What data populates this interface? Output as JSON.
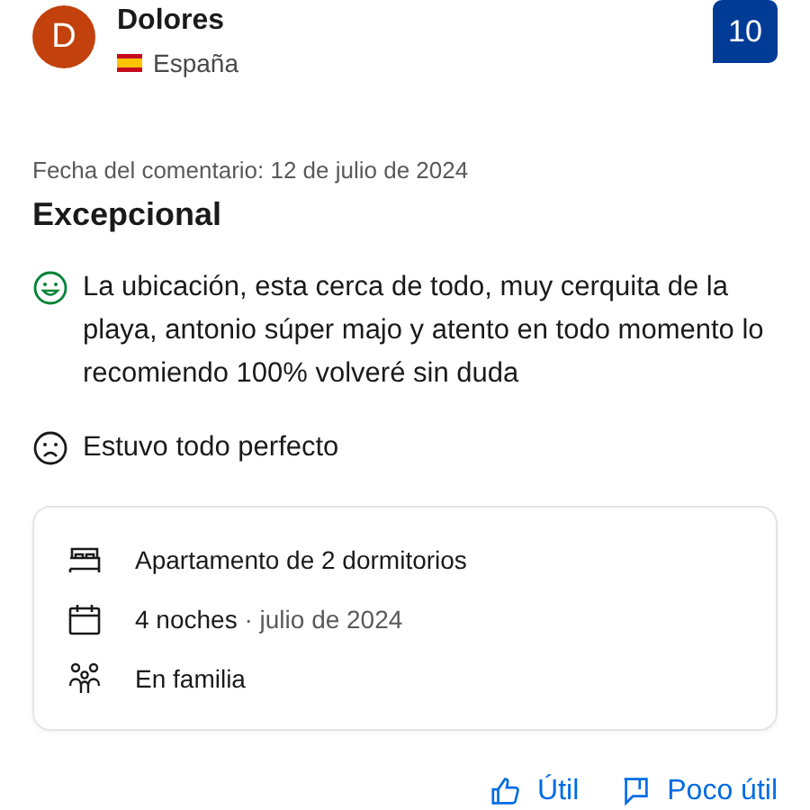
{
  "reviewer": {
    "initial": "D",
    "name": "Dolores",
    "country": "España"
  },
  "score": "10",
  "date": "Fecha del comentario: 12 de julio de 2024",
  "title": "Excepcional",
  "comments": [
    {
      "kind": "positive",
      "text": "La ubicación, esta cerca de todo, muy cerquita de la playa, antonio súper majo y atento en todo momento lo recomiendo 100% volveré sin duda"
    },
    {
      "kind": "negative",
      "text": "Estuvo todo perfecto"
    }
  ],
  "stay": [
    {
      "kind": "room",
      "text": "Apartamento de 2 dormitorios"
    },
    {
      "kind": "nights",
      "text": "4 noches",
      "detail": "· julio de 2024"
    },
    {
      "kind": "group",
      "text": "En familia"
    }
  ],
  "actions": [
    {
      "kind": "helpful",
      "label": "Útil"
    },
    {
      "kind": "unhelpful",
      "label": "Poco útil"
    }
  ]
}
